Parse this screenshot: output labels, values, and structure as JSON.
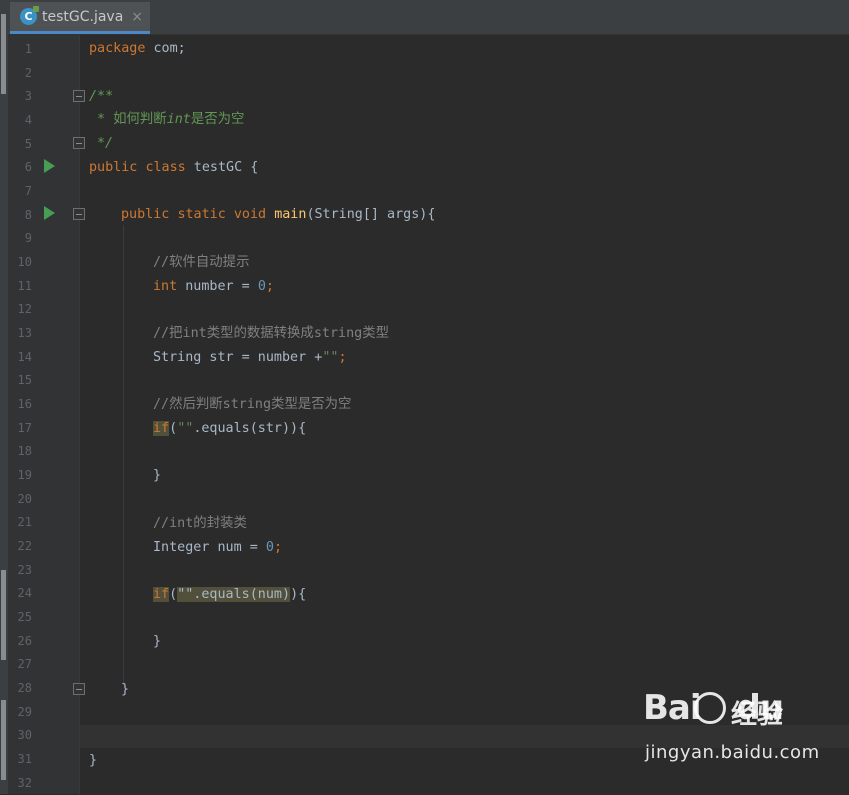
{
  "editor_tab": {
    "file_icon": "java-class-icon",
    "filename": "testGC.java",
    "close_label": "×"
  },
  "line_numbers": [
    "1",
    "2",
    "3",
    "4",
    "5",
    "6",
    "7",
    "8",
    "9",
    "10",
    "11",
    "12",
    "13",
    "14",
    "15",
    "16",
    "17",
    "18",
    "19",
    "20",
    "21",
    "22",
    "23",
    "24",
    "25",
    "26",
    "27",
    "28",
    "29",
    "30",
    "31",
    "32"
  ],
  "code": {
    "l1": {
      "kw": "package",
      "rest": " com;"
    },
    "l3": "/**",
    "l4": {
      "star": "* ",
      "a": "如何判断",
      "b": "int",
      "c": "是否为空"
    },
    "l5": "*/",
    "l6": {
      "kw1": "public",
      "kw2": "class",
      "rest": " testGC {"
    },
    "l8": {
      "kw1": "public",
      "kw2": "static",
      "kw3": "void",
      "fn": "main",
      "rest": "(String[] args){"
    },
    "l10": "//软件自动提示",
    "l11": {
      "kw": "int",
      "rest": " number = ",
      "num": "0",
      "end": ";"
    },
    "l13": "//把int类型的数据转换成string类型",
    "l14": {
      "rest": "String str = number +",
      "str": "\"\"",
      "end": ";"
    },
    "l16": "//然后判断string类型是否为空",
    "l17": {
      "kw": "if",
      "open": "(",
      "str": "\"\"",
      "rest": ".equals(str)){"
    },
    "l19": "}",
    "l21": "//int的封装类",
    "l22": {
      "rest": "Integer num = ",
      "num": "0",
      "end": ";"
    },
    "l24": {
      "kw": "if",
      "open": "(",
      "hl": "\"\".equals(num)",
      "rest": "){"
    },
    "l26": "}",
    "l28": "}",
    "l31": "}"
  },
  "gutter_icons": {
    "run_icon": "run-icon",
    "fold_icon": "fold-icon"
  },
  "watermark": {
    "logo_text": "Bai",
    "logo_text2": "du",
    "cn_text": "经验",
    "url": "jingyan.baidu.com"
  },
  "colors": {
    "background": "#2b2b2b",
    "keyword": "#cc7832",
    "method": "#ffc66d",
    "number": "#6897bb",
    "string": "#6a8759",
    "comment": "#808080",
    "doc_comment": "#629755",
    "tab_accent": "#4a88c7"
  }
}
